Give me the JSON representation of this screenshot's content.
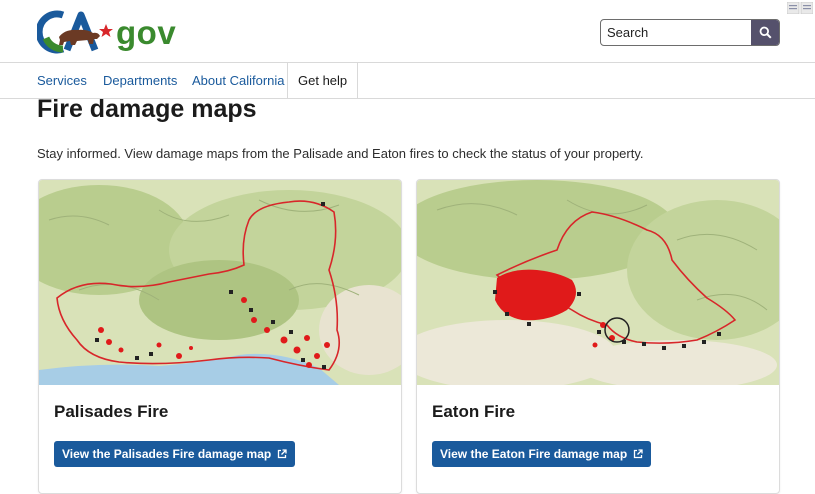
{
  "header": {
    "logo_text": "CA.gov",
    "logo_gov": "gov",
    "search": {
      "placeholder": "Search",
      "button_icon": "search-icon"
    },
    "language_icon": "translate-flag-icon"
  },
  "nav": {
    "items": [
      {
        "label": "Services",
        "active": false
      },
      {
        "label": "Departments",
        "active": false
      },
      {
        "label": "About California",
        "active": false
      },
      {
        "label": "Get help",
        "active": true
      }
    ]
  },
  "main": {
    "title": "Fire damage maps",
    "intro": "Stay informed. View damage maps from the Palisade and Eaton fires to check the status of your property.",
    "cards": [
      {
        "title": "Palisades Fire",
        "button_label": "View the Palisades Fire damage map",
        "button_icon": "external-link-icon"
      },
      {
        "title": "Eaton Fire",
        "button_label": "View the Eaton Fire damage map",
        "button_icon": "external-link-icon"
      }
    ]
  },
  "colors": {
    "primary_blue": "#1a5a9c",
    "logo_green": "#3a8a2e",
    "search_button": "#55516c",
    "fire_perimeter": "#d8262a",
    "damage_marker": "#e01a1a"
  }
}
